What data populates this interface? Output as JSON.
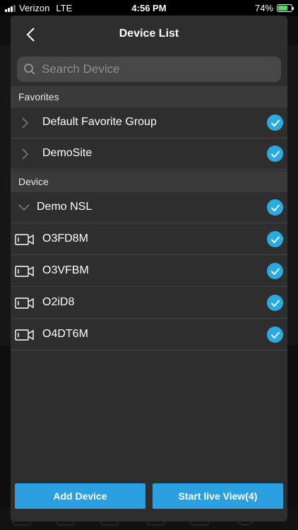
{
  "status_bar": {
    "carrier": "Verizon",
    "network": "LTE",
    "time": "4:56 PM",
    "battery_percent": "74%",
    "battery_level": 0.74
  },
  "header": {
    "title": "Device List"
  },
  "search": {
    "placeholder": "Search Device"
  },
  "favorites": {
    "section_label": "Favorites",
    "items": [
      {
        "label": "Default Favorite Group",
        "checked": true
      },
      {
        "label": "DemoSite",
        "checked": true
      }
    ]
  },
  "devices": {
    "section_label": "Device",
    "group": {
      "label": "Demo NSL",
      "expanded": true,
      "checked": true
    },
    "cameras": [
      {
        "label": "O3FD8M",
        "checked": true
      },
      {
        "label": "O3VFBM",
        "checked": true
      },
      {
        "label": "O2iD8",
        "checked": true
      },
      {
        "label": "O4DT6M",
        "checked": true
      }
    ]
  },
  "footer": {
    "add_label": "Add Device",
    "start_label": "Start live View(4)"
  },
  "colors": {
    "accent": "#29abe2",
    "button": "#2c9fe0",
    "panel": "#2e2e2e",
    "section": "#3a3a3a"
  }
}
